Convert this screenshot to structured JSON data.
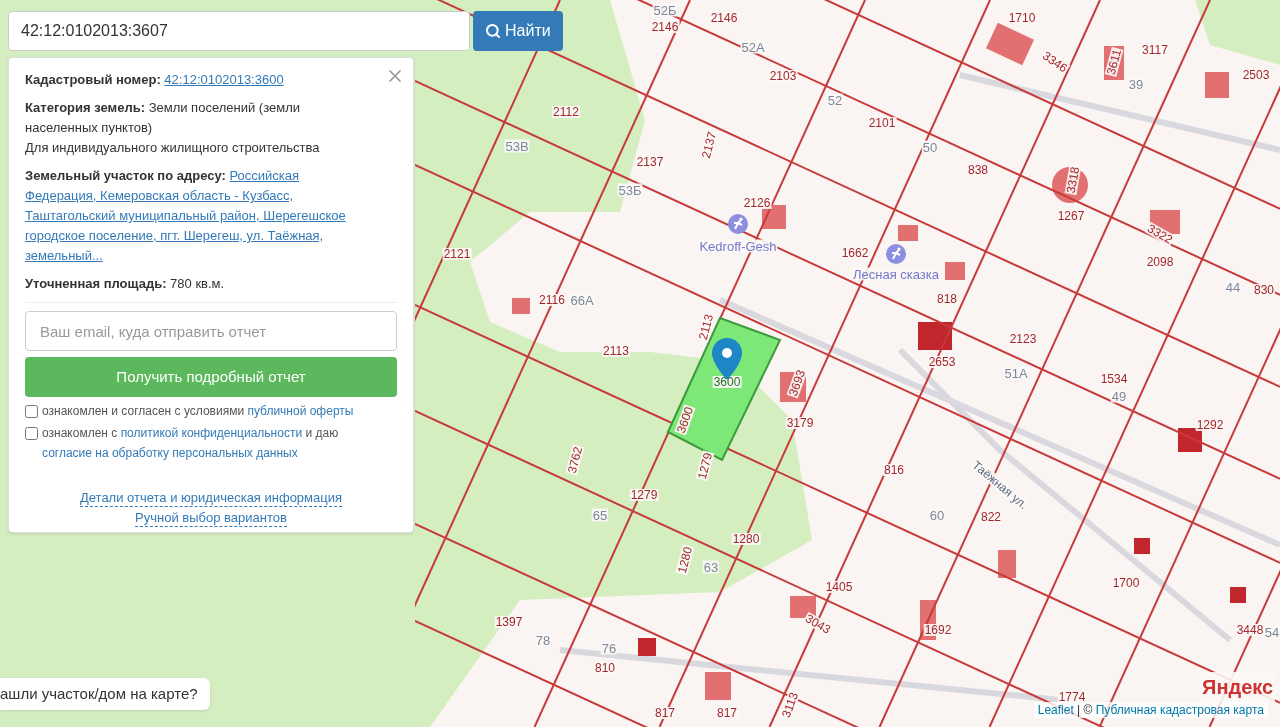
{
  "search": {
    "value": "42:12:0102013:3607",
    "button": "Найти"
  },
  "info_panel": {
    "fields": [
      {
        "kind": "link",
        "label": "Кадастровый номер:",
        "value": "42:12:0102013:3600"
      },
      {
        "kind": "text",
        "label": "Категория земель:",
        "value": "Земли поселений (земли населенных пунктов)"
      },
      {
        "kind": "plain",
        "value": "Для индивидуального жилищного строительства"
      },
      {
        "kind": "link",
        "label": "Земельный участок по адресу:",
        "value": "Российская Федерация, Кемеровская область - Кузбасс, Таштагольский муниципальный район, Шерегешское городское поселение, пгт. Шерегеш, ул. Таёжная, земельный..."
      },
      {
        "kind": "text",
        "label": "Уточненная площадь:",
        "value": "780 кв.м."
      }
    ],
    "email": {
      "placeholder": "Ваш email, куда отправить отчет"
    },
    "submit": "Получить подробный отчет",
    "consents": [
      {
        "checked": false,
        "parts": [
          {
            "text": "ознакомлен и согласен с условиями ",
            "link": false
          },
          {
            "text": "публичной оферты",
            "link": true
          }
        ]
      },
      {
        "checked": false,
        "parts": [
          {
            "text": "ознакомлен с ",
            "link": false
          },
          {
            "text": "политикой конфиденциальности",
            "link": true
          },
          {
            "text": " и даю ",
            "link": false
          },
          {
            "text": "согласие на обработку персональных данных",
            "link": true
          }
        ]
      }
    ],
    "footer_links": [
      "Детали отчета и юридическая информация",
      "Ручной выбор вариантов"
    ]
  },
  "map": {
    "labels": [
      {
        "text": "52Б",
        "kind": "house"
      },
      {
        "text": "2146",
        "kind": "parcel"
      },
      {
        "text": "2146",
        "kind": "parcel"
      },
      {
        "text": "1710",
        "kind": "parcel"
      },
      {
        "text": "3346",
        "kind": "parcel"
      },
      {
        "text": "3611",
        "kind": "parcel"
      },
      {
        "text": "3117",
        "kind": "parcel"
      },
      {
        "text": "39",
        "kind": "house"
      },
      {
        "text": "2503",
        "kind": "parcel"
      },
      {
        "text": "52А",
        "kind": "house"
      },
      {
        "text": "2103",
        "kind": "parcel"
      },
      {
        "text": "52",
        "kind": "house"
      },
      {
        "text": "2112",
        "kind": "parcel"
      },
      {
        "text": "2101",
        "kind": "parcel"
      },
      {
        "text": "2137",
        "kind": "parcel"
      },
      {
        "text": "53В",
        "kind": "house"
      },
      {
        "text": "50",
        "kind": "house"
      },
      {
        "text": "2137",
        "kind": "parcel"
      },
      {
        "text": "838",
        "kind": "parcel"
      },
      {
        "text": "3318",
        "kind": "parcel"
      },
      {
        "text": "53Б",
        "kind": "house"
      },
      {
        "text": "2126",
        "kind": "parcel"
      },
      {
        "text": "1267",
        "kind": "parcel"
      },
      {
        "text": "3322",
        "kind": "parcel"
      },
      {
        "text": "Kedroff-Gesh",
        "kind": "poi"
      },
      {
        "text": "1662",
        "kind": "parcel"
      },
      {
        "text": "2121",
        "kind": "parcel"
      },
      {
        "text": "2098",
        "kind": "parcel"
      },
      {
        "text": "Лесная сказка",
        "kind": "poi"
      },
      {
        "text": "44",
        "kind": "house"
      },
      {
        "text": "830",
        "kind": "parcel"
      },
      {
        "text": "2116",
        "kind": "parcel"
      },
      {
        "text": "66А",
        "kind": "house"
      },
      {
        "text": "818",
        "kind": "parcel"
      },
      {
        "text": "2113",
        "kind": "parcel"
      },
      {
        "text": "2123",
        "kind": "parcel"
      },
      {
        "text": "2113",
        "kind": "parcel"
      },
      {
        "text": "2653",
        "kind": "parcel"
      },
      {
        "text": "51А",
        "kind": "house"
      },
      {
        "text": "3600",
        "kind": "selected"
      },
      {
        "text": "3693",
        "kind": "parcel"
      },
      {
        "text": "1534",
        "kind": "parcel"
      },
      {
        "text": "49",
        "kind": "house"
      },
      {
        "text": "3600",
        "kind": "parcel"
      },
      {
        "text": "3179",
        "kind": "parcel"
      },
      {
        "text": "1292",
        "kind": "parcel"
      },
      {
        "text": "3762",
        "kind": "parcel"
      },
      {
        "text": "1279",
        "kind": "parcel"
      },
      {
        "text": "816",
        "kind": "parcel"
      },
      {
        "text": "Таёжная ул.",
        "kind": "street"
      },
      {
        "text": "1279",
        "kind": "parcel"
      },
      {
        "text": "65",
        "kind": "house"
      },
      {
        "text": "60",
        "kind": "house"
      },
      {
        "text": "822",
        "kind": "parcel"
      },
      {
        "text": "1280",
        "kind": "parcel"
      },
      {
        "text": "1280",
        "kind": "parcel"
      },
      {
        "text": "63",
        "kind": "house"
      },
      {
        "text": "1700",
        "kind": "parcel"
      },
      {
        "text": "1405",
        "kind": "parcel"
      },
      {
        "text": "1397",
        "kind": "parcel"
      },
      {
        "text": "3043",
        "kind": "parcel"
      },
      {
        "text": "1692",
        "kind": "parcel"
      },
      {
        "text": "3448",
        "kind": "parcel"
      },
      {
        "text": "54",
        "kind": "house"
      },
      {
        "text": "78",
        "kind": "house"
      },
      {
        "text": "76",
        "kind": "house"
      },
      {
        "text": "810",
        "kind": "parcel"
      },
      {
        "text": "1774",
        "kind": "parcel"
      },
      {
        "text": "3113",
        "kind": "parcel"
      },
      {
        "text": "817",
        "kind": "parcel"
      },
      {
        "text": "817",
        "kind": "parcel"
      }
    ],
    "help_button": "ашли участок/дом на карте?",
    "logo": "Яндекс",
    "attribution": [
      {
        "text": "Leaflet",
        "link": true
      },
      {
        "text": " | © ",
        "link": false
      },
      {
        "text": "Публичная кадастровая карта",
        "link": true
      }
    ]
  }
}
